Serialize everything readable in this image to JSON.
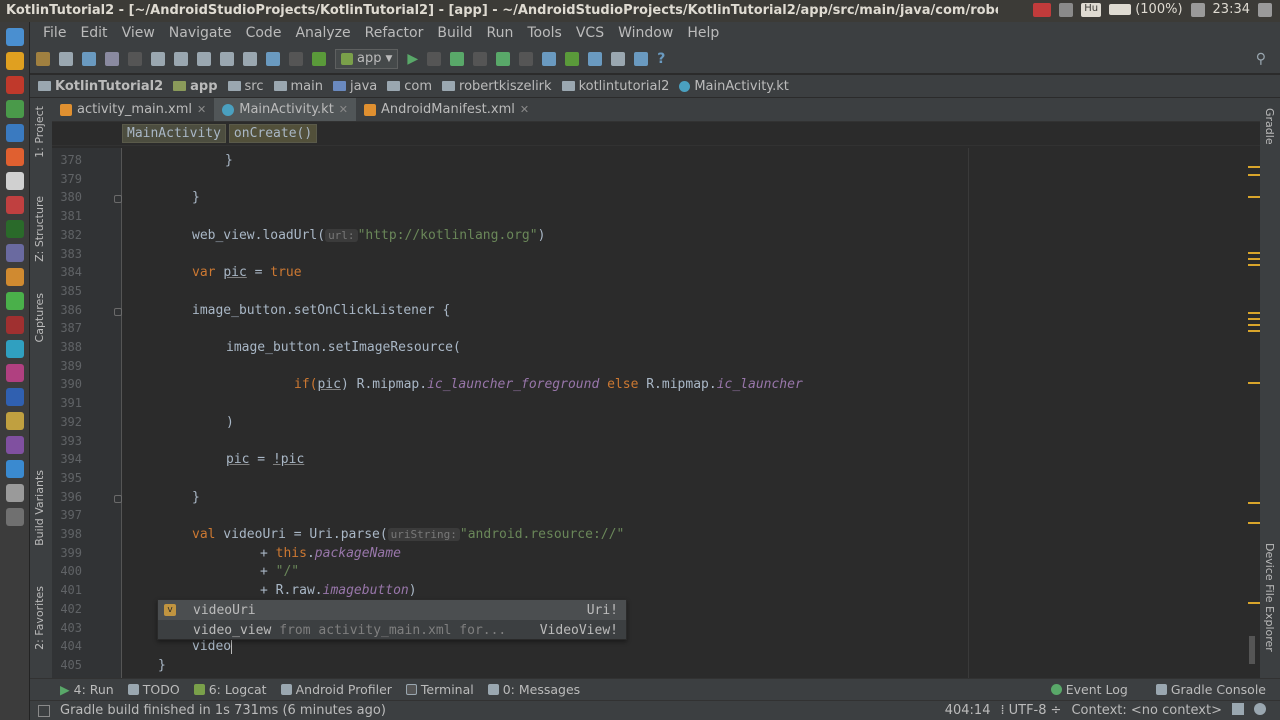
{
  "system": {
    "window_title": "KotlinTutorial2 - [~/AndroidStudioProjects/KotlinTutorial2] - [app] - ~/AndroidStudioProjects/KotlinTutorial2/app/src/main/java/com/robertkiszelir",
    "keyboard": "Hu",
    "battery": "(100%)",
    "clock": "23:34"
  },
  "menu": [
    "File",
    "Edit",
    "View",
    "Navigate",
    "Code",
    "Analyze",
    "Refactor",
    "Build",
    "Run",
    "Tools",
    "VCS",
    "Window",
    "Help"
  ],
  "toolbar": {
    "run_config": "app"
  },
  "nav_breadcrumb": [
    "KotlinTutorial2",
    "app",
    "src",
    "main",
    "java",
    "com",
    "robertkiszelirk",
    "kotlintutorial2",
    "MainActivity.kt"
  ],
  "tabs": [
    {
      "label": "activity_main.xml",
      "active": false
    },
    {
      "label": "MainActivity.kt",
      "active": true
    },
    {
      "label": "AndroidManifest.xml",
      "active": false
    }
  ],
  "editor_breadcrumb": {
    "class": "MainActivity",
    "method": "onCreate()"
  },
  "left_tool_tabs": {
    "project": "1: Project",
    "structure": "Z: Structure",
    "captures": "Captures",
    "build_variants": "Build Variants",
    "favorites": "2: Favorites"
  },
  "right_tool_tabs": {
    "gradle": "Gradle",
    "device_explorer": "Device File Explorer"
  },
  "lines": {
    "n378": "378",
    "n379": "379",
    "n380": "380",
    "n381": "381",
    "n382": "382",
    "n383": "383",
    "n384": "384",
    "n385": "385",
    "n386": "386",
    "n387": "387",
    "n388": "388",
    "n389": "389",
    "n390": "390",
    "n391": "391",
    "n392": "392",
    "n393": "393",
    "n394": "394",
    "n395": "395",
    "n396": "396",
    "n397": "397",
    "n398": "398",
    "n399": "399",
    "n400": "400",
    "n401": "401",
    "n402": "402",
    "n403": "403",
    "n404": "404",
    "n405": "405"
  },
  "code": {
    "brace": "}",
    "web_view": "web_view.loadUrl(",
    "url_hint": "url:",
    "url_str": "\"http://kotlinlang.org\"",
    "close_paren": ")",
    "var_kw": "var",
    "pic": "pic",
    "eq": " = ",
    "true_kw": "true",
    "listener": "image_button.setOnClickListener {",
    "set_image": "image_button.setImageResource(",
    "if_kw": "if(",
    "close_paren_sp": ") ",
    "r_mipmap": "R.mipmap.",
    "ic_fg": "ic_launcher_foreground",
    "else_kw": " else ",
    "ic_launcher": "ic_launcher",
    "not_pic": "!pic",
    "val_kw": "val",
    "video_uri_decl": " videoUri = Uri.parse(",
    "uri_hint": "uriString:",
    "android_res": "\"android.resource://\"",
    "plus": "+ ",
    "this_kw": "this",
    "dot": ".",
    "package_name": "packageName",
    "slash_str": "\"/\"",
    "r_raw": "R.raw.",
    "imagebutton": "imagebutton",
    "typed": "video"
  },
  "completion": [
    {
      "name": "videoUri",
      "detail": "",
      "type": "Uri!"
    },
    {
      "name": "video_view",
      "detail": "from activity_main.xml for...",
      "type": "VideoView!"
    }
  ],
  "bottom_tools": [
    "4: Run",
    "TODO",
    "6: Logcat",
    "Android Profiler",
    "Terminal",
    "0: Messages"
  ],
  "bottom_right_tools": [
    "Event Log",
    "Gradle Console"
  ],
  "status": {
    "message": "Gradle build finished in 1s 731ms (6 minutes ago)",
    "position": "404:14",
    "encoding": "UTF-8",
    "context": "Context: <no context>"
  },
  "colors": {
    "keyword": "#cc7832",
    "string": "#6a8759",
    "property": "#9876aa",
    "text": "#a9b7c6",
    "background": "#2b2b2b"
  }
}
